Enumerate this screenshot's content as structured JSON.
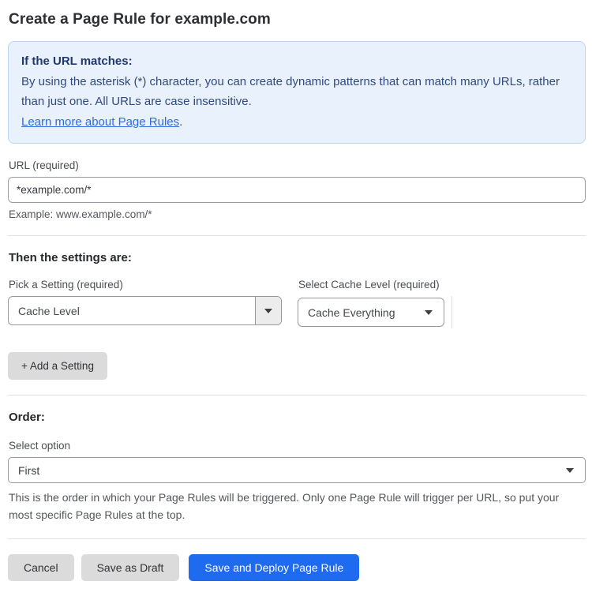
{
  "page": {
    "title": "Create a Page Rule for example.com"
  },
  "info_box": {
    "heading": "If the URL matches:",
    "body": "By using the asterisk (*) character, you can create dynamic patterns that can match many URLs, rather than just one. All URLs are case insensitive.",
    "link_label": "Learn more about Page Rules",
    "link_suffix": "."
  },
  "url_field": {
    "label": "URL (required)",
    "value": "*example.com/*",
    "example": "Example: www.example.com/*"
  },
  "settings": {
    "heading": "Then the settings are:",
    "setting_select": {
      "label": "Pick a Setting (required)",
      "value": "Cache Level"
    },
    "cache_level_select": {
      "label": "Select Cache Level (required)",
      "value": "Cache Everything"
    },
    "add_button_label": "+ Add a Setting"
  },
  "order": {
    "heading": "Order:",
    "label": "Select option",
    "value": "First",
    "help": "This is the order in which your Page Rules will be triggered. Only one Page Rule will trigger per URL, so put your most specific Page Rules at the top."
  },
  "footer": {
    "cancel_label": "Cancel",
    "save_draft_label": "Save as Draft",
    "save_deploy_label": "Save and Deploy Page Rule"
  },
  "colors": {
    "accent_blue": "#1f6bf0",
    "info_background": "#e8f1fc",
    "info_border": "#bcd5f2",
    "info_text": "#31497e",
    "link_blue": "#2e6bdf",
    "button_gray": "#dbdbdb"
  }
}
